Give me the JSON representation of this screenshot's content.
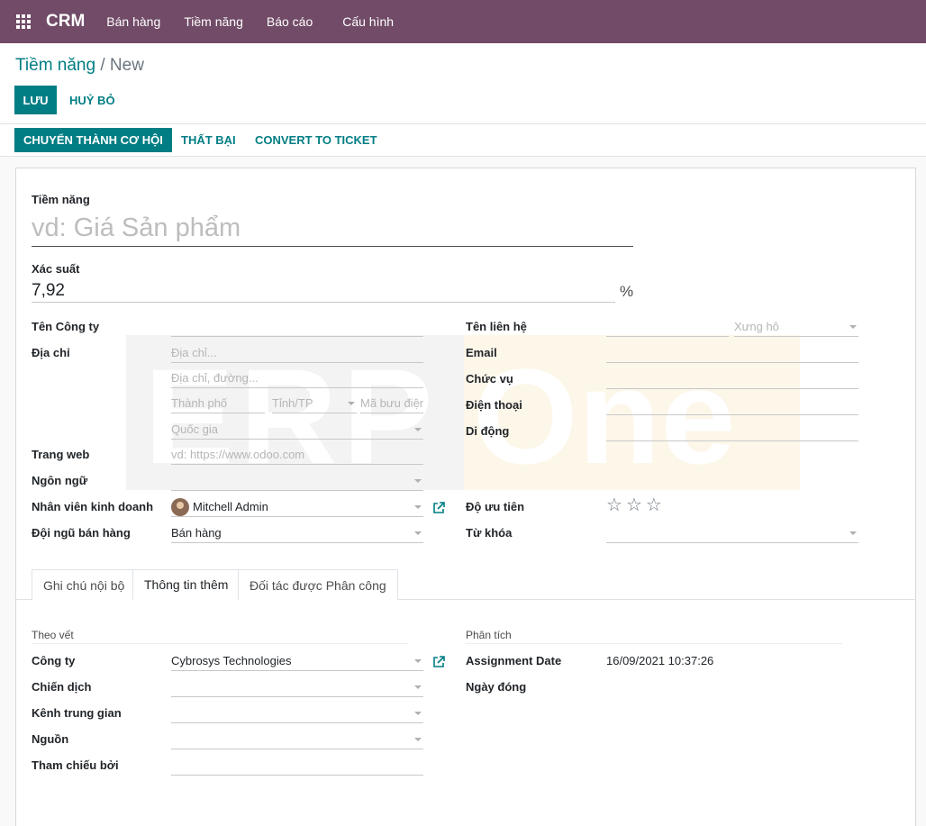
{
  "navbar": {
    "brand": "CRM",
    "menu": [
      "Bán hàng",
      "Tiềm năng",
      "Báo cáo",
      "Cấu hình"
    ]
  },
  "breadcrumb": {
    "parent": "Tiềm năng",
    "separator": "/",
    "current": "New"
  },
  "buttons": {
    "save": "LƯU",
    "discard": "HUỶ BỎ"
  },
  "status_buttons": {
    "convert": "CHUYỂN THÀNH CƠ HỘI",
    "lost": "THẤT BẠI",
    "ticket": "CONVERT TO TICKET"
  },
  "form": {
    "title_label": "Tiềm năng",
    "title_placeholder": "vd: Giá Sản phẩm",
    "probability_label": "Xác suất",
    "probability_value": "7,92",
    "probability_unit": "%",
    "left": {
      "company_name_label": "Tên Công ty",
      "address_label": "Địa chỉ",
      "street_placeholder": "Địa chỉ...",
      "street2_placeholder": "Địa chỉ, đường...",
      "city_placeholder": "Thành phố",
      "state_placeholder": "Tỉnh/TP",
      "zip_placeholder": "Mã bưu điện",
      "country_placeholder": "Quốc gia",
      "website_label": "Trang web",
      "website_placeholder": "vd: https://www.odoo.com",
      "language_label": "Ngôn ngữ",
      "salesperson_label": "Nhân viên kinh doanh",
      "salesperson_value": "Mitchell Admin",
      "sales_team_label": "Đội ngũ bán hàng",
      "sales_team_value": "Bán hàng"
    },
    "right": {
      "contact_name_label": "Tên liên hệ",
      "title_placeholder": "Xưng hô",
      "email_label": "Email",
      "job_label": "Chức vụ",
      "phone_label": "Điện thoại",
      "mobile_label": "Di động",
      "priority_label": "Độ ưu tiên",
      "priority_stars": 3,
      "tags_label": "Từ khóa"
    }
  },
  "watermark": {
    "left": "ERP",
    "right": "One"
  },
  "tabs": [
    "Ghi chú nội bộ",
    "Thông tin thêm",
    "Đối tác được Phân công"
  ],
  "extra": {
    "tracking_title": "Theo vết",
    "company_label": "Công ty",
    "company_value": "Cybrosys Technologies",
    "campaign_label": "Chiến dịch",
    "medium_label": "Kênh trung gian",
    "source_label": "Nguồn",
    "referred_label": "Tham chiếu bởi",
    "analysis_title": "Phân tích",
    "assignment_date_label": "Assignment Date",
    "assignment_date_value": "16/09/2021 10:37:26",
    "closed_date_label": "Ngày đóng"
  },
  "colors": {
    "navbar": "#714b67",
    "primary": "#017e84"
  }
}
